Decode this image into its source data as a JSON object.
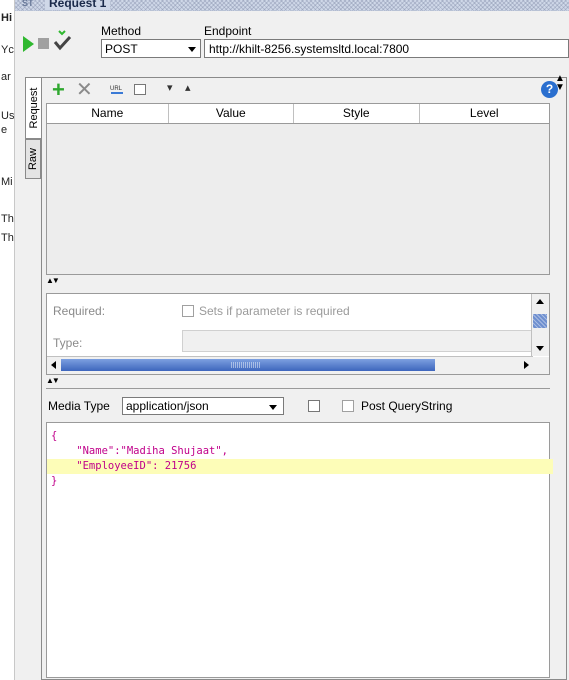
{
  "left_strip": [
    "Hi",
    "Yc",
    "ar",
    "Us",
    "e",
    "Mi",
    "Th",
    "Th"
  ],
  "window": {
    "badge": "ST",
    "title": "Request 1"
  },
  "toolbar": {
    "method_label": "Method",
    "method_value": "POST",
    "endpoint_label": "Endpoint",
    "endpoint_value": "http://khilt-8256.systemsltd.local:7800"
  },
  "side_tabs": {
    "request": "Request",
    "raw": "Raw"
  },
  "params_table": {
    "columns": [
      "Name",
      "Value",
      "Style",
      "Level"
    ]
  },
  "param_props": {
    "required_label": "Required:",
    "required_hint": "Sets if parameter is required",
    "type_label": "Type:"
  },
  "media": {
    "label": "Media Type",
    "value": "application/json",
    "post_querystring_label": "Post QueryString"
  },
  "body_lines": {
    "line1": "{",
    "line2": "    \"Name\":\"Madiha Shujaat\",",
    "line3": "    \"EmployeeID\": 21756",
    "line4": "}"
  },
  "icons": {
    "help": "?"
  }
}
